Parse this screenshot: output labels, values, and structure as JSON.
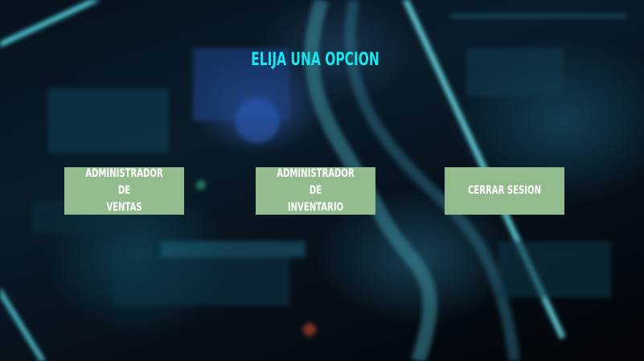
{
  "title": "ELIJA UNA OPCION",
  "buttons": {
    "ventas": "ADMINISTRADOR DE\nVENTAS",
    "inventario": "ADMINISTRADOR DE\nINVENTARIO",
    "cerrar": "CERRAR SESION"
  },
  "colors": {
    "title": "#19e6ee",
    "button_bg": "#93bc8e",
    "button_text": "#ffffff",
    "background": "#040a12"
  }
}
